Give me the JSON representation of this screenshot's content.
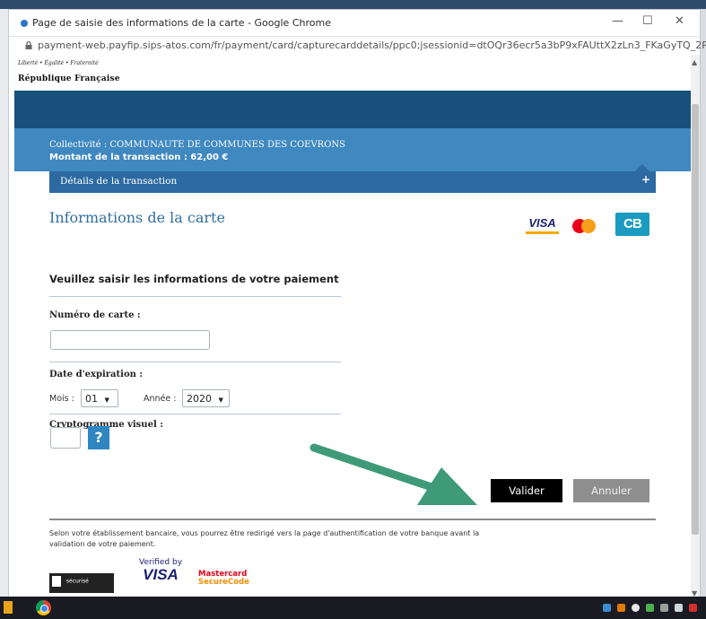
{
  "browser": {
    "window_title": "Page de saisie des informations de la carte - Google Chrome",
    "url": "payment-web.payfip.sips-atos.com/fr/payment/card/capturecarddetails/ppc0;jsessionid=dtOQr36ecr5a3bP9xFAUttX2zLn3_FKaGyTQ_2P...",
    "minimize_label": "—",
    "maximize_label": "☐",
    "close_label": "✕"
  },
  "header": {
    "motto": "Liberté • Égalité • Fraternité",
    "republic": "République Française"
  },
  "transaction": {
    "collectivite": "Collectivité : COMMUNAUTE DE COMMUNES DES COEVRONS",
    "montant": "Montant de la transaction :   62,00 €",
    "details_label": "Détails de la transaction",
    "details_toggle": "+"
  },
  "card_section": {
    "heading": "Informations de la carte",
    "logos": {
      "visa": "VISA",
      "cb": "CB"
    }
  },
  "form": {
    "title": "Veuillez saisir les informations de votre paiement",
    "card_number_label": "Numéro de carte :",
    "card_number_value": "",
    "expiry_label": "Date d'expiration :",
    "month_label": "Mois :",
    "month_value": "01",
    "year_label": "Année :",
    "year_value": "2020",
    "cvv_label": "Cryptogramme visuel :",
    "cvv_value": "",
    "help_label": "?"
  },
  "buttons": {
    "validate": "Valider",
    "cancel": "Annuler"
  },
  "footer": {
    "notice": "Selon votre établissement bancaire, vous pourrez être redirigé vers la page d'authentification de votre banque avant la validation de votre paiement.",
    "secure_label": "sécurisé",
    "verified_by": "Verified by",
    "visa_brand": "VISA",
    "mc_line1": "Mastercard",
    "mc_line2": "SecureCode"
  },
  "colors": {
    "dark_band": "#17507a",
    "light_band": "#3f88c0",
    "details_bar": "#2c6aa1",
    "heading_blue": "#2f6f9f",
    "validate_bg": "#000000",
    "cancel_bg": "#8e8e8e",
    "annotation_arrow": "#3e9a78"
  }
}
